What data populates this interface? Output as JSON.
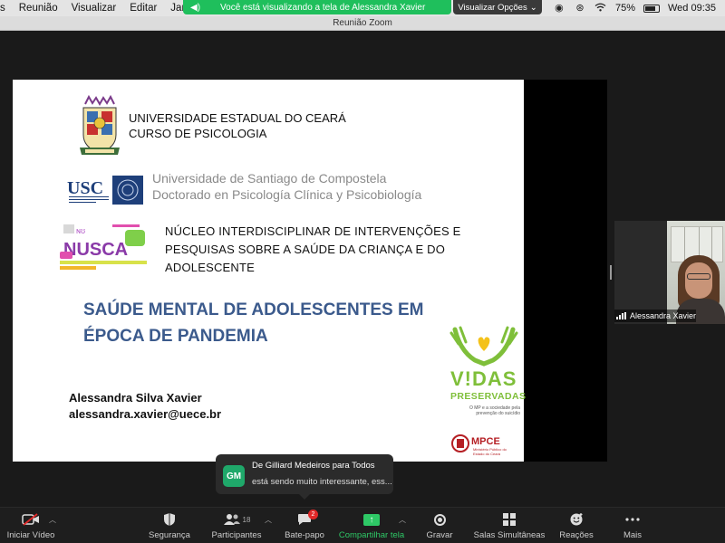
{
  "menubar": {
    "menus": [
      "s",
      "Reunião",
      "Visualizar",
      "Editar",
      "Janela"
    ],
    "battery": "75%",
    "clock": "Wed 09:35"
  },
  "share_banner": {
    "text": "Você está visualizando a tela de Alessandra Xavier",
    "view_options": "Visualizar Opções"
  },
  "window_title": "Reunião Zoom",
  "slide": {
    "uece": [
      "UNIVERSIDADE ESTADUAL DO CEARÁ",
      "CURSO DE PSICOLOGIA"
    ],
    "usc_logo": "USC",
    "usc": [
      "Universidade de Santiago de Compostela",
      "Doctorado en Psicología Clínica y Psicobiología"
    ],
    "nucleo": [
      "NÚCLEO INTERDISCIPLINAR DE INTERVENÇÕES E",
      "PESQUISAS SOBRE A SAÚDE DA CRIANÇA E DO",
      "ADOLESCENTE"
    ],
    "title": [
      "SAÚDE MENTAL DE ADOLESCENTES EM",
      "ÉPOCA DE PANDEMIA"
    ],
    "author_name": "Alessandra Silva Xavier",
    "author_email": "alessandra.xavier@uece.br",
    "campaign": {
      "line1": "V!DAS",
      "line2": "PRESERVADAS",
      "tagline": "O MP e a sociedade pela prevenção do suicídio",
      "org": "MPCE",
      "org_sub": "Ministério Público do Estado do Ceará"
    }
  },
  "participant": {
    "name": "Alessandra Xavier"
  },
  "chat_toast": {
    "initials": "GM",
    "from": "De Gilliard Medeiros para Todos",
    "message": "está sendo muito interessante, ess..."
  },
  "toolbar": {
    "start_video": "Iniciar Vídeo",
    "security": "Segurança",
    "participants": "Participantes",
    "participants_count": "18",
    "chat": "Bate-papo",
    "chat_badge": "2",
    "share": "Compartilhar tela",
    "record": "Gravar",
    "breakout": "Salas Simultâneas",
    "reactions": "Reações",
    "more": "Mais"
  },
  "colors": {
    "share_green": "#1fbf5c",
    "title_blue": "#3b5a8c",
    "campaign_green": "#7fbf3a",
    "mpce_red": "#b51f24"
  }
}
